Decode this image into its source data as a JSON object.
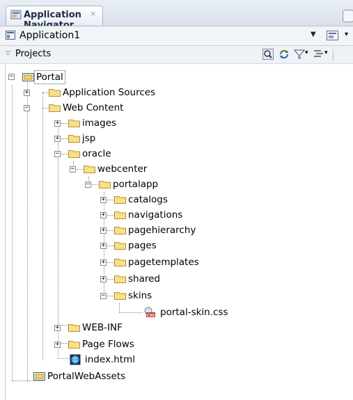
{
  "tab": {
    "title": "Application Navigator",
    "close": "×"
  },
  "app_selector": {
    "value": "Application1"
  },
  "projects_panel": {
    "title": "Projects"
  },
  "tree": [
    {
      "label": "Portal",
      "type": "app-folder",
      "expander": "−",
      "selected": true
    },
    {
      "label": "Application Sources",
      "type": "folder",
      "expander": "+"
    },
    {
      "label": "Web Content",
      "type": "folder",
      "expander": "−"
    },
    {
      "label": "images",
      "type": "folder",
      "expander": "+"
    },
    {
      "label": "jsp",
      "type": "folder",
      "expander": "+"
    },
    {
      "label": "oracle",
      "type": "folder",
      "expander": "−"
    },
    {
      "label": "webcenter",
      "type": "folder",
      "expander": "−"
    },
    {
      "label": "portalapp",
      "type": "folder",
      "expander": "−"
    },
    {
      "label": "catalogs",
      "type": "folder",
      "expander": "+"
    },
    {
      "label": "navigations",
      "type": "folder",
      "expander": "+"
    },
    {
      "label": "pagehierarchy",
      "type": "folder",
      "expander": "+"
    },
    {
      "label": "pages",
      "type": "folder",
      "expander": "+"
    },
    {
      "label": "pagetemplates",
      "type": "folder",
      "expander": "+"
    },
    {
      "label": "shared",
      "type": "folder",
      "expander": "+"
    },
    {
      "label": "skins",
      "type": "folder",
      "expander": "−"
    },
    {
      "label": "portal-skin.css",
      "type": "css-file"
    },
    {
      "label": "WEB-INF",
      "type": "folder",
      "expander": "+"
    },
    {
      "label": "Page Flows",
      "type": "folder",
      "expander": "+"
    },
    {
      "label": "index.html",
      "type": "html-file"
    },
    {
      "label": "PortalWebAssets",
      "type": "app-folder"
    }
  ],
  "colors": {
    "folder_fill": "#f7e08a",
    "folder_stroke": "#b0903a",
    "selection": "#3b5a8a",
    "css_badge": "#c0392b"
  }
}
